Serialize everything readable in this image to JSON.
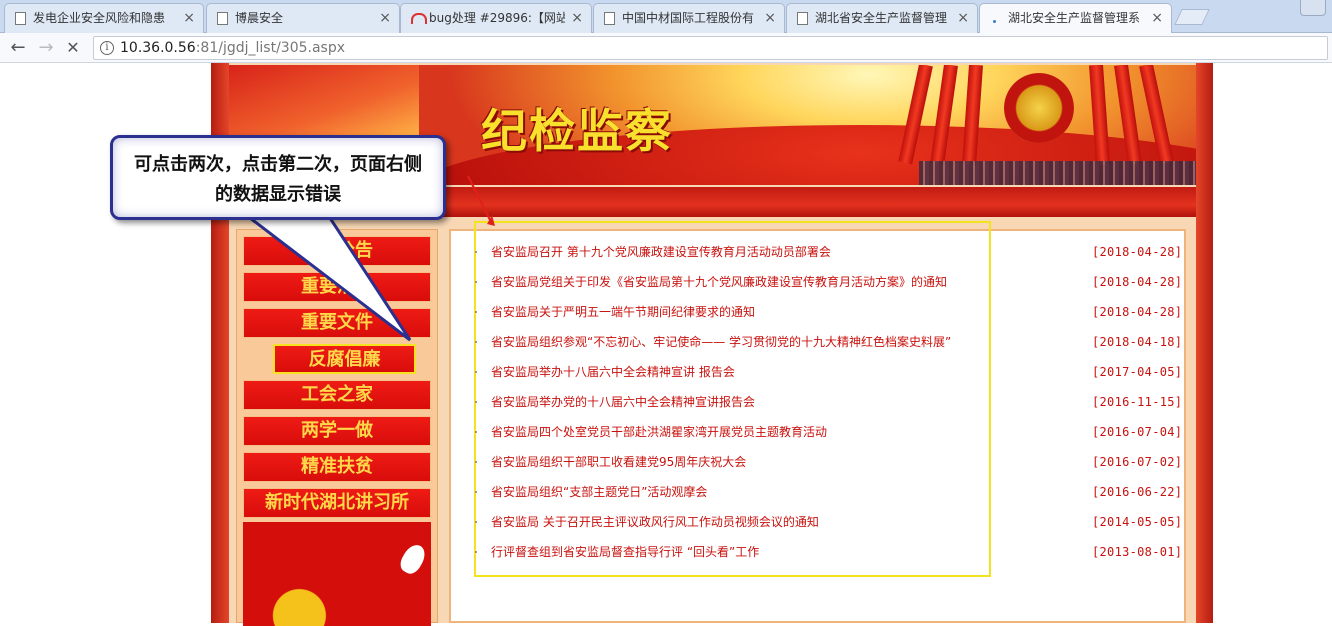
{
  "browser": {
    "tabs": [
      {
        "title": "发电企业安全风险和隐患",
        "icon": "page-icon"
      },
      {
        "title": "博晨安全",
        "icon": "page-icon"
      },
      {
        "title": "bug处理 #29896:【网站",
        "icon": "bug-tracker-icon"
      },
      {
        "title": "中国中材国际工程股份有",
        "icon": "page-icon"
      },
      {
        "title": "湖北省安全生产监督管理",
        "icon": "page-icon"
      },
      {
        "title": "湖北安全生产监督管理系",
        "icon": "loading-dot-icon"
      }
    ],
    "tab_close_glyph": "×",
    "url_host": "10.36.0.56",
    "url_path": ":81/jgdj_list/305.aspx",
    "back_glyph": "←",
    "forward_glyph": "→",
    "stop_glyph": "✕",
    "info_glyph": "i"
  },
  "site": {
    "banner_title": "纪检监察",
    "nav": [
      {
        "label": "通知公告"
      },
      {
        "label": "重要活动"
      },
      {
        "label": "重要文件"
      },
      {
        "label": "反腐倡廉",
        "selected": true
      },
      {
        "label": "工会之家"
      },
      {
        "label": "两学一做"
      },
      {
        "label": "精准扶贫"
      },
      {
        "label": "新时代湖北讲习所"
      }
    ],
    "articles": [
      {
        "title": "省安监局召开 第十九个党风廉政建设宣传教育月活动动员部署会",
        "date": "[2018-04-28]"
      },
      {
        "title": "省安监局党组关于印发《省安监局第十九个党风廉政建设宣传教育月活动方案》的通知",
        "date": "[2018-04-28]"
      },
      {
        "title": "省安监局关于严明五一端午节期间纪律要求的通知",
        "date": "[2018-04-28]"
      },
      {
        "title": "省安监局组织参观“不忘初心、牢记使命—— 学习贯彻党的十九大精神红色档案史料展”",
        "date": "[2018-04-18]"
      },
      {
        "title": "省安监局举办十八届六中全会精神宣讲 报告会",
        "date": "[2017-04-05]"
      },
      {
        "title": "省安监局举办党的十八届六中全会精神宣讲报告会",
        "date": "[2016-11-15]"
      },
      {
        "title": "省安监局四个处室党员干部赴洪湖瞿家湾开展党员主题教育活动",
        "date": "[2016-07-04]"
      },
      {
        "title": "省安监局组织干部职工收看建党95周年庆祝大会",
        "date": "[2016-07-02]"
      },
      {
        "title": "省安监局组织“支部主题党日”活动观摩会",
        "date": "[2016-06-22]"
      },
      {
        "title": "省安监局 关于召开民主评议政风行风工作动员视频会议的通知",
        "date": "[2014-05-05]"
      },
      {
        "title": "行评督查组到省安监局督查指导行评 “回头看”工作",
        "date": "[2013-08-01]"
      }
    ]
  },
  "annotation": {
    "callout_line1": "可点击两次，点击第二次，页面右侧",
    "callout_line2": "的数据显示错误"
  }
}
